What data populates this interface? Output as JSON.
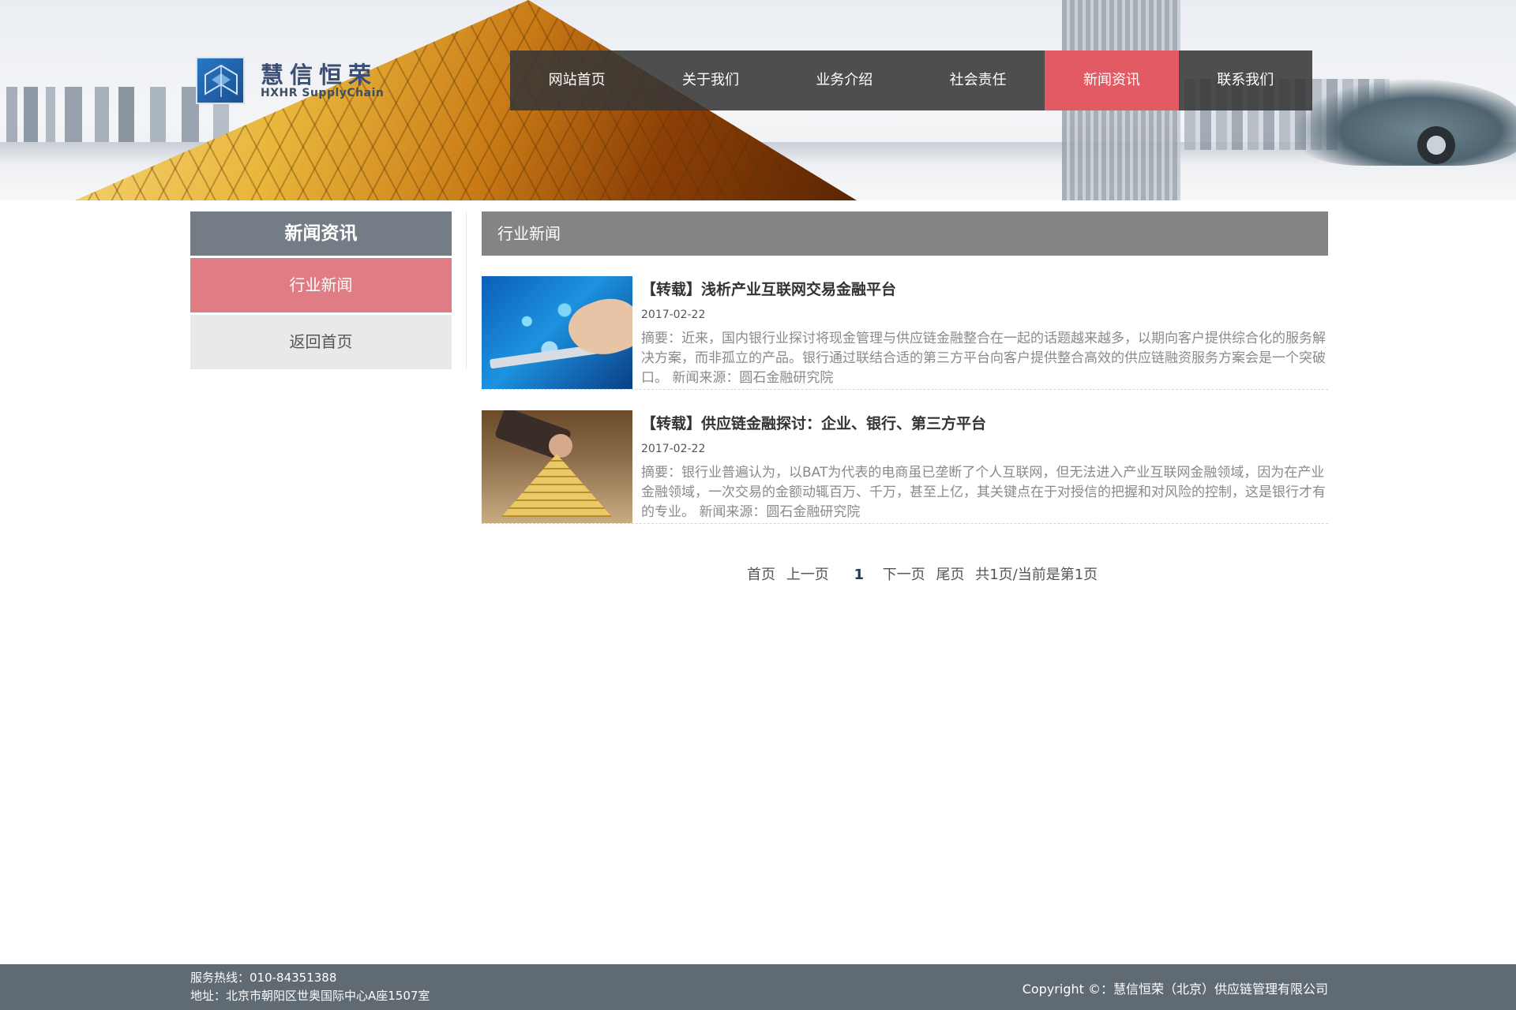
{
  "logo": {
    "name_cn": "慧信恒荣",
    "name_en": "HXHR SupplyChain"
  },
  "nav": {
    "items": [
      {
        "label": "网站首页"
      },
      {
        "label": "关于我们"
      },
      {
        "label": "业务介绍"
      },
      {
        "label": "社会责任"
      },
      {
        "label": "新闻资讯",
        "active": true
      },
      {
        "label": "联系我们"
      }
    ],
    "active_color": "#e25a64"
  },
  "sidebar": {
    "title": "新闻资讯",
    "items": [
      {
        "label": "行业新闻",
        "active": true
      },
      {
        "label": "返回首页",
        "active": false
      }
    ]
  },
  "main": {
    "title": "行业新闻",
    "articles": [
      {
        "title": "【转载】浅析产业互联网交易金融平台",
        "date": "2017-02-22",
        "summary": "摘要：近来，国内银行业探讨将现金管理与供应链金融整合在一起的话题越来越多，以期向客户提供综合化的服务解决方案，而非孤立的产品。银行通过联结合适的第三方平台向客户提供整合高效的供应链融资服务方案会是一个突破口。 新闻来源：圆石金融研究院",
        "thumbnail": "tablet-hand-image"
      },
      {
        "title": "【转载】供应链金融探讨：企业、银行、第三方平台",
        "date": "2017-02-22",
        "summary": "摘要：银行业普遍认为，以BAT为代表的电商虽已垄断了个人互联网，但无法进入产业互联网金融领域，因为在产业金融领域，一次交易的金额动辄百万、千万，甚至上亿，其关键点在于对授信的把握和对风险的控制，这是银行才有的专业。 新闻来源：圆石金融研究院",
        "thumbnail": "gold-pyramid-image"
      }
    ]
  },
  "pager": {
    "first": "首页",
    "prev": "上一页",
    "current": "1",
    "next": "下一页",
    "last": "尾页",
    "info": "共1页/当前是第1页"
  },
  "footer": {
    "hotline": "服务热线：010-84351388",
    "address": "地址：北京市朝阳区世奥国际中心A座1507室",
    "copyright": "Copyright ©：慧信恒荣（北京）供应链管理有限公司"
  }
}
